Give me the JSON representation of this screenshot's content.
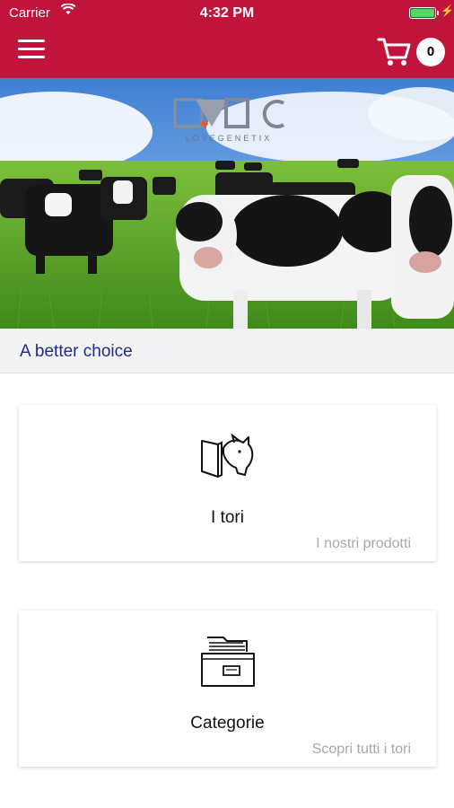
{
  "status_bar": {
    "carrier": "Carrier",
    "time": "4:32 PM"
  },
  "navbar": {
    "menu_icon": "hamburger-menu-icon",
    "cart_icon": "shopping-cart-icon",
    "cart_count": "0",
    "color": "#c0143c"
  },
  "hero": {
    "logo_text": "LOVEGENETIX",
    "logo_mark": "ABC"
  },
  "tagline": "A better choice",
  "cards": [
    {
      "icon": "bull-catalog-icon",
      "title": "I tori",
      "subtitle": "I nostri prodotti"
    },
    {
      "icon": "file-drawer-icon",
      "title": "Categorie",
      "subtitle": "Scopri tutti i tori"
    }
  ],
  "colors": {
    "accent": "#c0143c",
    "tagline_text": "#1f2a8a",
    "battery": "#4cd964"
  }
}
